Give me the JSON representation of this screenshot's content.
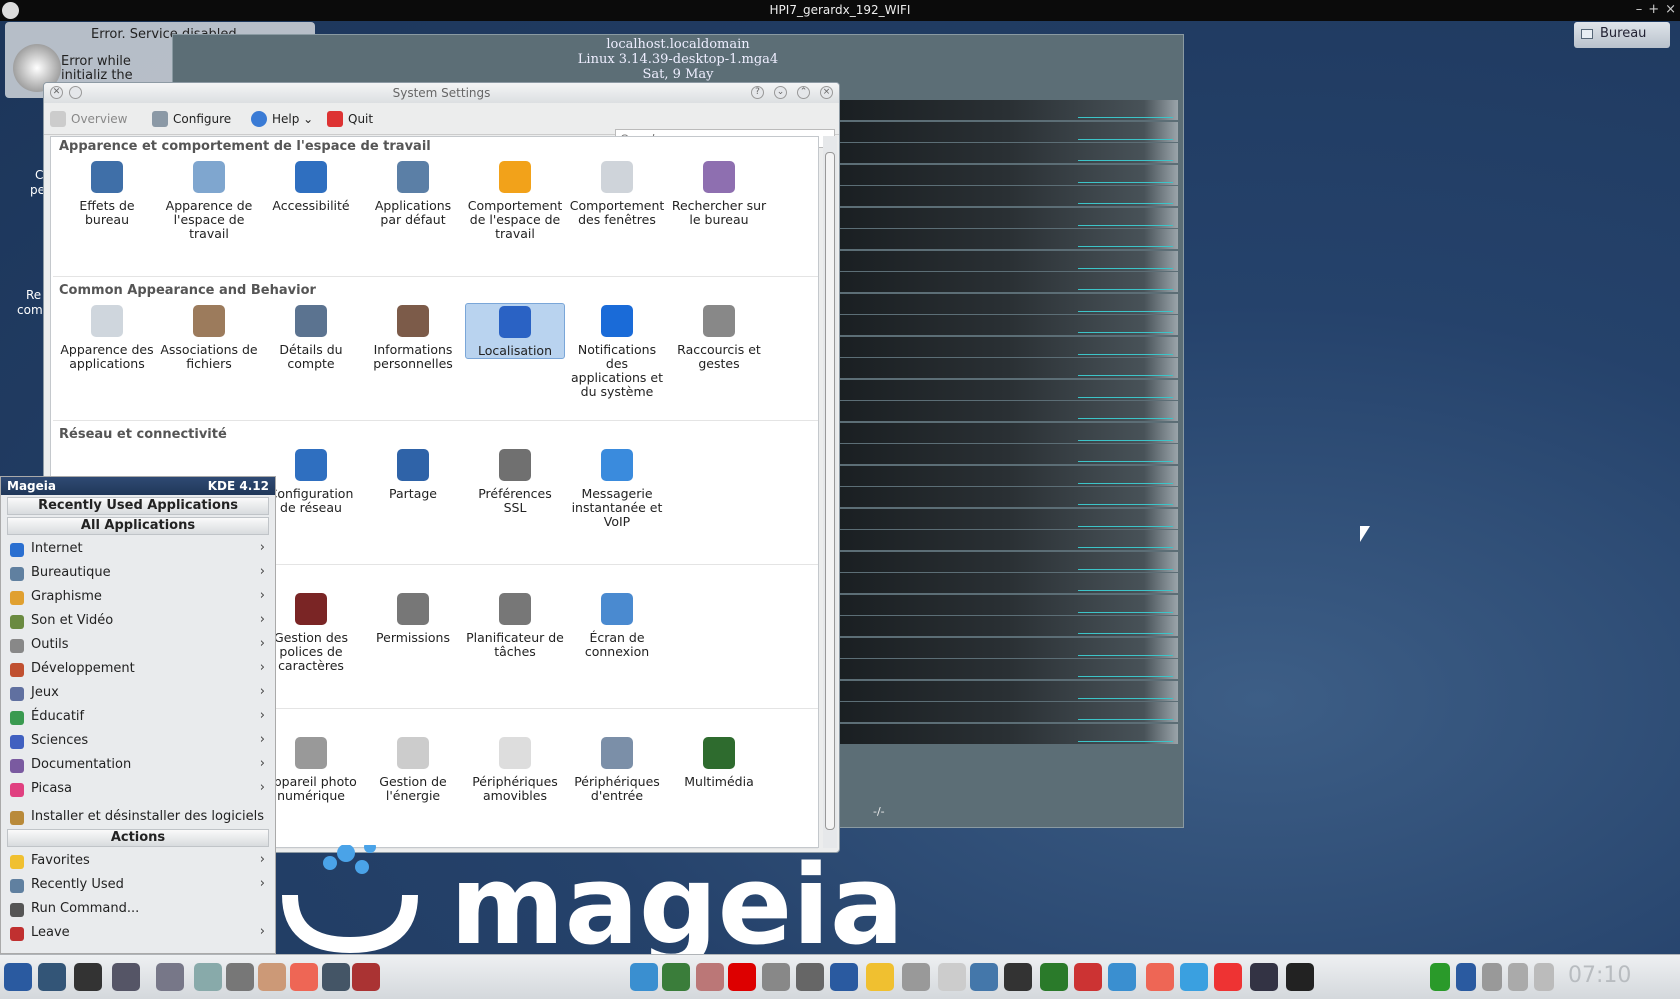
{
  "topbar": {
    "title": "HPI7_gerardx_192_WIFI",
    "controls": [
      "–",
      "+",
      "×"
    ]
  },
  "desktop": {
    "bureau_button": "Bureau",
    "labels": [
      "C",
      "pe",
      "Re",
      "com"
    ]
  },
  "error_notification": {
    "title": "Error. Service disabled",
    "message": "Error while initializ the service."
  },
  "monitor": {
    "hostname": "localhost.localdomain",
    "kernel": "Linux 3.14.39-desktop-1.mga4",
    "date": "Sat, 9 May",
    "footer": "-/-"
  },
  "settings": {
    "title": "System Settings",
    "toolbar": {
      "overview": "Overview",
      "configure": "Configure",
      "help": "Help",
      "quit": "Quit"
    },
    "search_placeholder": "Search",
    "sections": [
      {
        "title": "Apparence et comportement de l'espace de travail",
        "items": [
          "Effets de bureau",
          "Apparence de l'espace de travail",
          "Accessibilité",
          "Applications par défaut",
          "Comportement de l'espace de travail",
          "Comportement des fenêtres",
          "Rechercher sur le bureau"
        ]
      },
      {
        "title": "Common Appearance and Behavior",
        "items": [
          "Apparence des applications",
          "Associations de fichiers",
          "Détails du compte",
          "Informations personnelles",
          "Localisation",
          "Notifications des applications et du système",
          "Raccourcis et gestes"
        ]
      },
      {
        "title": "Réseau et connectivité",
        "items": [
          "Configuration de réseau",
          "Partage",
          "Préférences SSL",
          "Messagerie instantanée et VoIP"
        ]
      },
      {
        "title": "",
        "items": [
          "Gestion des polices de caractères",
          "Permissions",
          "Planificateur de tâches",
          "Écran de connexion"
        ]
      },
      {
        "title": "",
        "items": [
          "Appareil photo numérique",
          "Gestion de l'énergie",
          "Périphériques amovibles",
          "Périphériques d'entrée",
          "Multimédia"
        ]
      }
    ]
  },
  "menu": {
    "header_left": "Mageia",
    "header_right": "KDE 4.12",
    "recent_btn": "Recently Used Applications",
    "all_btn": "All Applications",
    "categories": [
      "Internet",
      "Bureautique",
      "Graphisme",
      "Son et Vidéo",
      "Outils",
      "Développement",
      "Jeux",
      "Éducatif",
      "Sciences",
      "Documentation",
      "Picasa"
    ],
    "install": "Installer et désinstaller des logiciels",
    "actions_header": "Actions",
    "actions": [
      "Favorites",
      "Recently Used",
      "Run Command...",
      "Leave"
    ]
  },
  "brand": {
    "logo_text": "mageia"
  },
  "taskbar": {
    "clock": "07:10"
  },
  "colors": {
    "desktop_bg": "#25426b",
    "menu_header": "#203759",
    "selection": "#b9d3ef"
  }
}
